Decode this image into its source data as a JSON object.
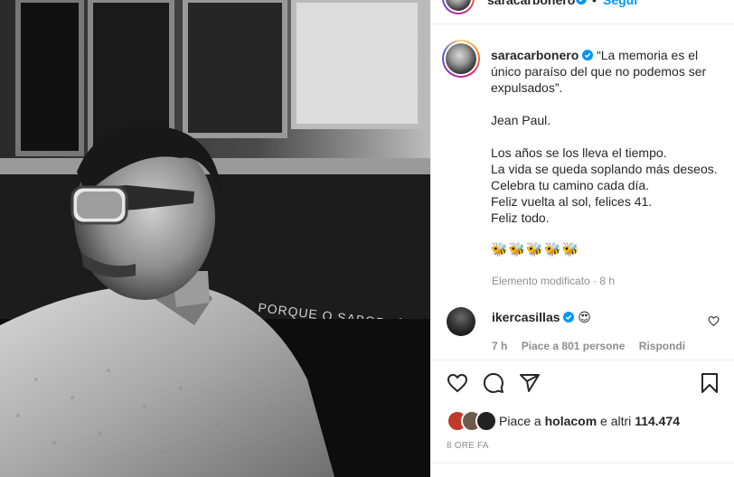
{
  "post": {
    "username": "saracarbonero",
    "follow_label": "Segui",
    "dot": "•",
    "caption_lines": [
      "“La memoria es el único paraíso del que no podemos ser expulsados”."
    ],
    "caption_author": "Jean Paul.",
    "caption_poem": [
      "Los años se los lleva el tiempo.",
      "La vida se queda soplando más deseos.",
      "Celebra tu camino cada día.",
      "Feliz vuelta al sol, felices 41.",
      "Feliz todo."
    ],
    "caption_emojis": "🐝🐝🐝🐝🐝",
    "caption_meta": "Elemento modificato · 8 h",
    "photo_text": "PORQUE O SABOR, É ESS"
  },
  "comment": {
    "username": "ikercasillas",
    "text": "😍",
    "time": "7 h",
    "likes": "Piace a 801 persone",
    "reply": "Rispondi"
  },
  "likes": {
    "prefix": "Piace a ",
    "user": "holacom",
    "middle": " e altri ",
    "count": "114.474"
  },
  "time_ago": "8 ORE FA",
  "icons": [
    "heart-icon",
    "comment-icon",
    "share-icon",
    "bookmark-icon",
    "verified-icon"
  ],
  "colors": {
    "verified": "#0095f6",
    "follow": "#0095f6",
    "muted": "#8e8e8e",
    "text": "#262626"
  }
}
